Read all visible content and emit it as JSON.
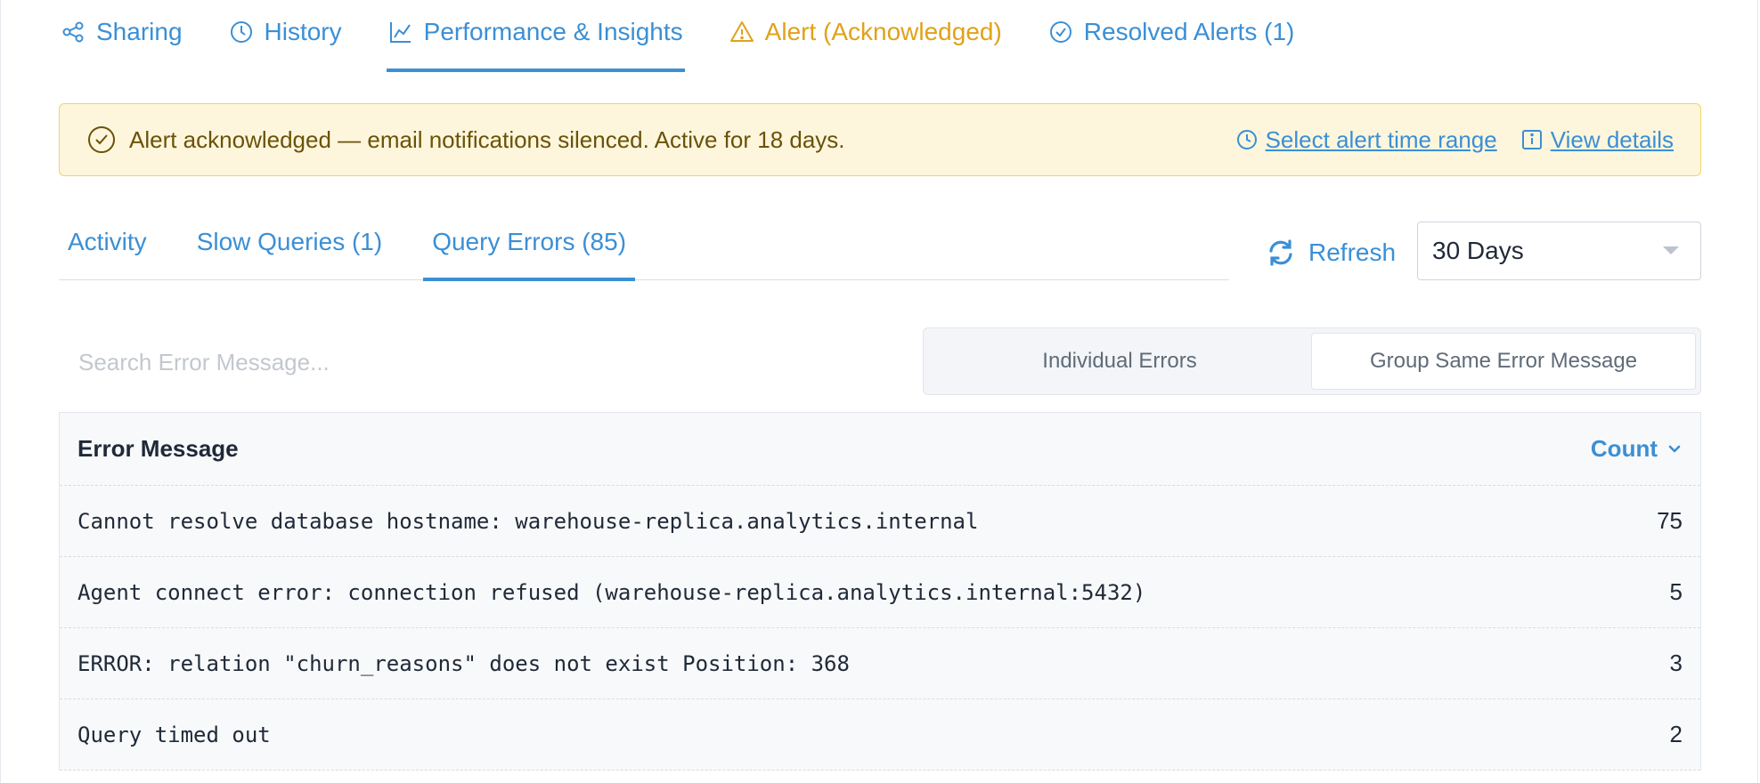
{
  "top_tabs": [
    {
      "label": "Sharing",
      "icon": "share-icon",
      "active": false
    },
    {
      "label": "History",
      "icon": "clock-icon",
      "active": false
    },
    {
      "label": "Performance & Insights",
      "icon": "line-chart-icon",
      "active": true
    },
    {
      "label": "Alert (Acknowledged)",
      "icon": "warning-icon",
      "active": false
    },
    {
      "label": "Resolved Alerts (1)",
      "icon": "check-circle-icon",
      "active": false
    }
  ],
  "banner": {
    "message": "Alert acknowledged — email notifications silenced. Active for 18 days.",
    "time_range_link": "Select alert time range",
    "details_link": "View details",
    "background": "#fdf6dc",
    "border": "#f0d469"
  },
  "sub_tabs": [
    {
      "label": "Activity",
      "active": false
    },
    {
      "label": "Slow Queries (1)",
      "active": false
    },
    {
      "label": "Query Errors (85)",
      "active": true
    }
  ],
  "refresh_label": "Refresh",
  "range_select": {
    "value": "30 Days"
  },
  "search": {
    "placeholder": "Search Error Message..."
  },
  "toggle": {
    "individual_label": "Individual Errors",
    "group_label": "Group Same Error Message",
    "selected": "group"
  },
  "table": {
    "col_message": "Error Message",
    "col_count": "Count",
    "sort": "descending",
    "rows": [
      {
        "message": "Cannot resolve database hostname: warehouse-replica.analytics.internal",
        "count": "75"
      },
      {
        "message": "Agent connect error: connection refused (warehouse-replica.analytics.internal:5432)",
        "count": "5"
      },
      {
        "message": "ERROR: relation \"churn_reasons\" does not exist Position: 368",
        "count": "3"
      },
      {
        "message": "Query timed out",
        "count": "2"
      }
    ]
  },
  "colors": {
    "accent": "#3b8fd5",
    "warning": "#e0a21a"
  }
}
